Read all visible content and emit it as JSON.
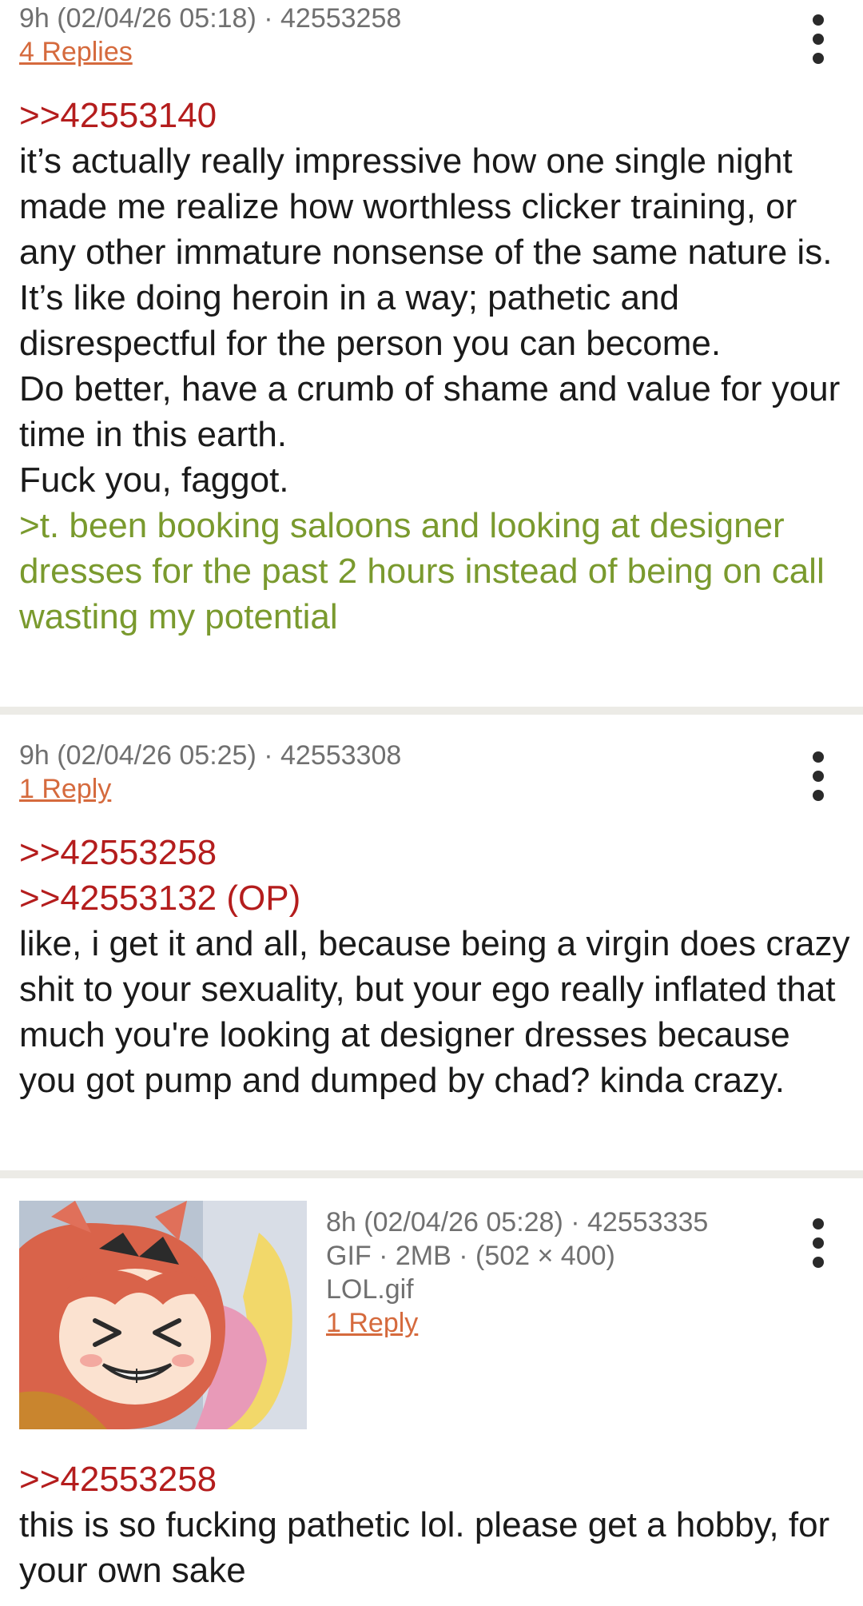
{
  "posts": [
    {
      "meta": "9h (02/04/26 05:18) · 42553258",
      "replies": "4 Replies",
      "quote1": ">>42553140",
      "text1": "it’s actually really impressive how one single night made me realize how worthless clicker training, or any other immature nonsense of the same nature is. It’s like doing heroin in a way; pathetic and disrespectful for the person you can become.",
      "text2": "Do better, have a crumb of shame and value for your time in this earth.",
      "text3": "Fuck you, faggot.",
      "greentext": ">t. been booking saloons and looking at designer dresses for the past 2 hours instead of being on call wasting my potential",
      "menu_icon": "more-vertical-icon"
    },
    {
      "meta": "9h (02/04/26 05:25) · 42553308",
      "replies": "1 Reply",
      "quote1": ">>42553258",
      "quote2": ">>42553132 (OP)",
      "text1": "like, i get it and all, because being a virgin does crazy shit to your sexuality, but your ego really inflated that much you're looking at designer dresses because you got pump and dumped by chad? kinda crazy.",
      "menu_icon": "more-vertical-icon"
    },
    {
      "meta": "8h (02/04/26 05:28) · 42553335",
      "file_info": "GIF · 2MB · (502 × 400)",
      "file_name": "LOL.gif",
      "replies": "1 Reply",
      "quote1": ">>42553258",
      "text1": "this is so fucking pathetic lol. please get a hobby, for your own sake",
      "thumbnail_icon": "anime-girl-thumbnail",
      "menu_icon": "more-vertical-icon"
    }
  ],
  "colors": {
    "quotelink": "#b41d1d",
    "greentext": "#7a9a2e",
    "replies": "#d56a3d",
    "meta": "#707070",
    "divider": "#ecebe6"
  }
}
